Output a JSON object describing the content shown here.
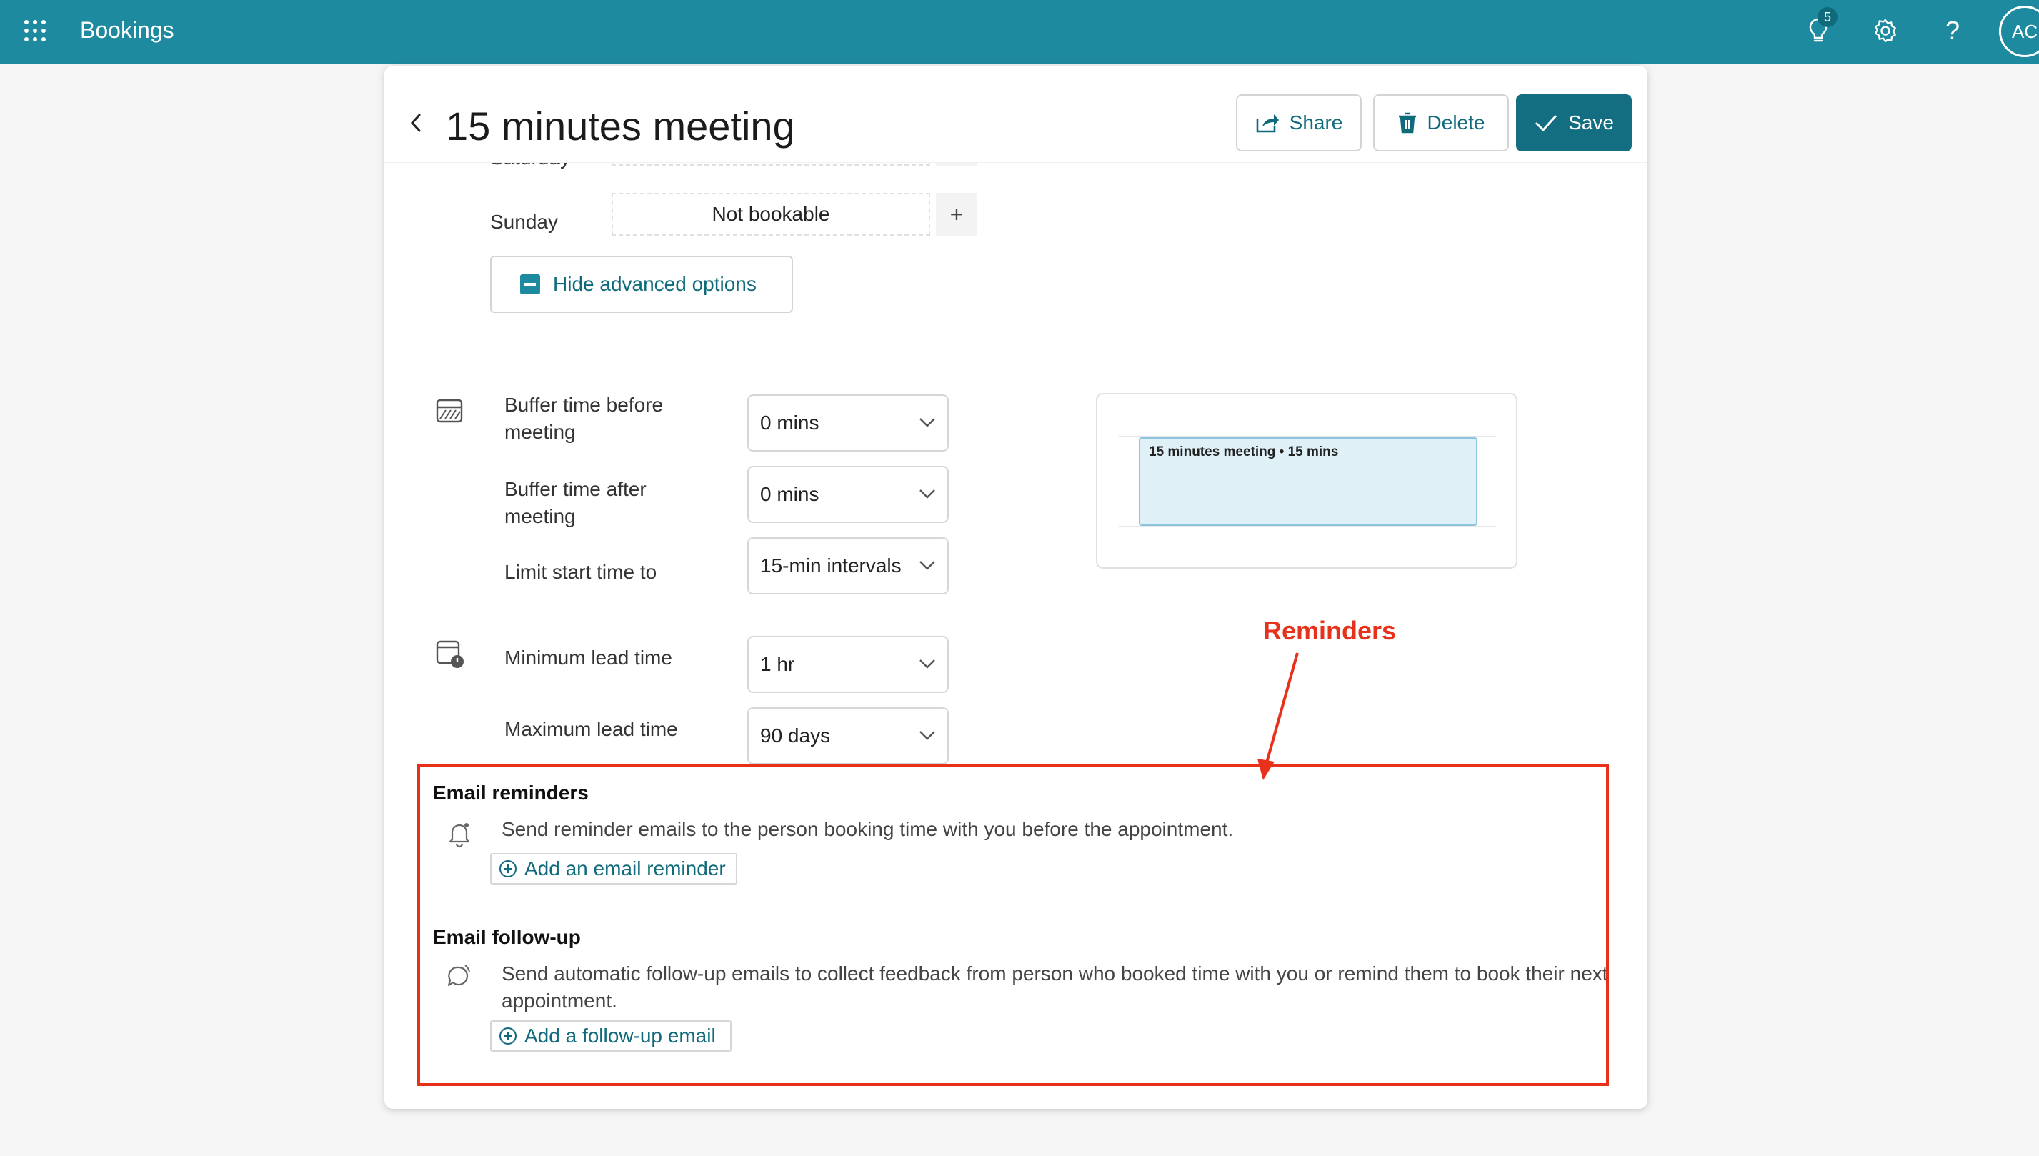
{
  "topbar": {
    "app_title": "Bookings",
    "notification_count": "5",
    "avatar_initials": "AC",
    "background_color": "#1e8aa0"
  },
  "header": {
    "title": "15 minutes meeting",
    "share_label": "Share",
    "delete_label": "Delete",
    "save_label": "Save"
  },
  "availability": {
    "saturday_label": "Saturday",
    "sunday_label": "Sunday",
    "sunday_value": "Not bookable",
    "add_symbol": "+",
    "hide_advanced_label": "Hide advanced options"
  },
  "advanced": {
    "buffer_before_label": "Buffer time before meeting",
    "buffer_before_value": "0 mins",
    "buffer_after_label": "Buffer time after meeting",
    "buffer_after_value": "0 mins",
    "limit_start_label": "Limit start time to",
    "limit_start_value": "15-min intervals",
    "min_lead_label": "Minimum lead time",
    "min_lead_value": "1 hr",
    "max_lead_label": "Maximum lead time",
    "max_lead_value": "90 days"
  },
  "preview": {
    "event_text": "15 minutes meeting • 15 mins"
  },
  "annotation": {
    "label": "Reminders",
    "color": "#e8311a"
  },
  "email_reminders": {
    "title": "Email reminders",
    "description": "Send reminder emails to the person booking time with you before the appointment.",
    "add_label": "Add an email reminder"
  },
  "email_followup": {
    "title": "Email follow-up",
    "description": "Send automatic follow-up emails to collect feedback from person who booked time with you or remind them to book their next appointment.",
    "add_label": "Add a follow-up email"
  }
}
